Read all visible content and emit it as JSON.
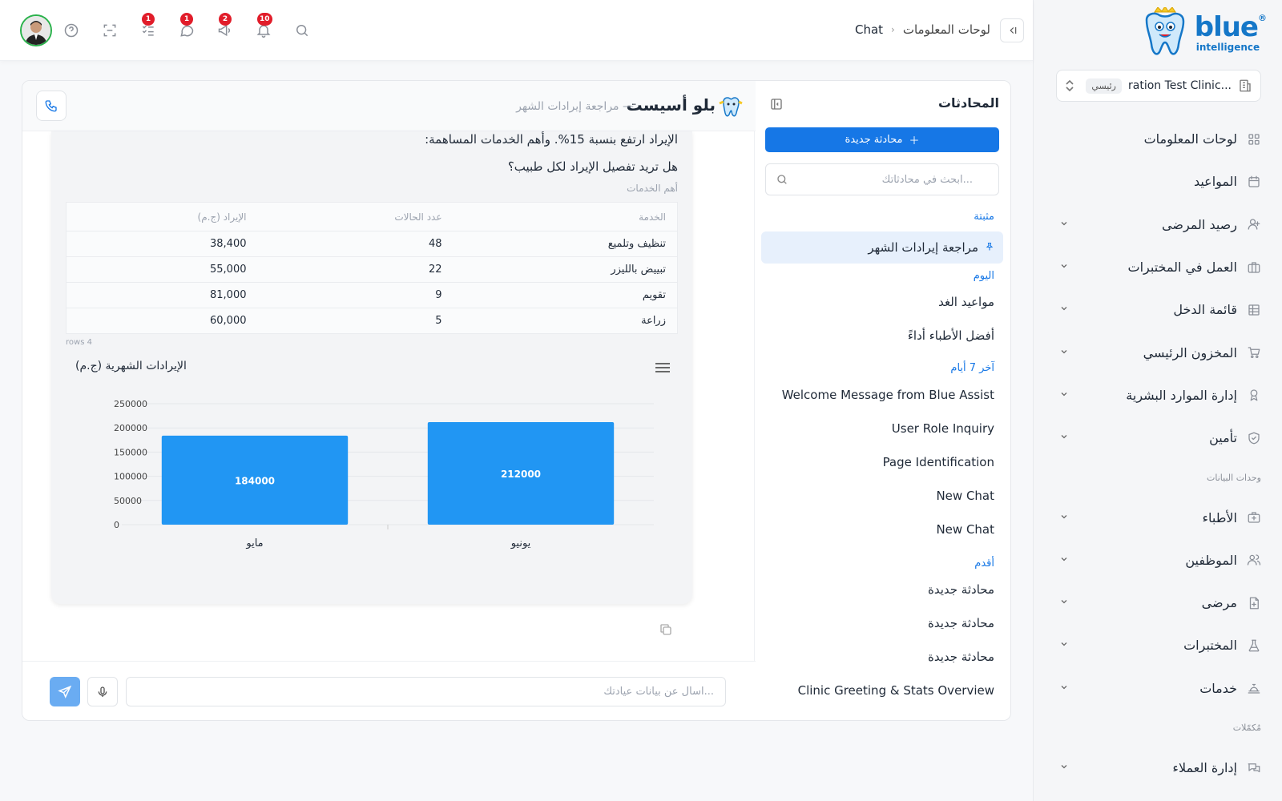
{
  "brand": {
    "name": "blue",
    "sub": "intelligence",
    "reg": "®"
  },
  "clinic": {
    "name": "...ration Test Clinic",
    "badge": "رئيسي"
  },
  "nav": {
    "items": [
      {
        "label": "لوحات المعلومات",
        "icon": "dashboard-icon",
        "chevron": false
      },
      {
        "label": "المواعيد",
        "icon": "calendar-icon",
        "chevron": false
      },
      {
        "label": "رصيد المرضى",
        "icon": "user-icon",
        "chevron": true
      },
      {
        "label": "العمل في المختبرات",
        "icon": "briefcase-icon",
        "chevron": true
      },
      {
        "label": "قائمة الدخل",
        "icon": "table-icon",
        "chevron": true
      },
      {
        "label": "المخزون الرئيسي",
        "icon": "cart-icon",
        "chevron": true
      },
      {
        "label": "إدارة الموارد البشرية",
        "icon": "badge-icon",
        "chevron": true
      },
      {
        "label": "تأمين",
        "icon": "shield-icon",
        "chevron": true
      }
    ],
    "section_data": "وحدات البيانات",
    "data_items": [
      {
        "label": "الأطباء",
        "icon": "medical-bag-icon",
        "chevron": true
      },
      {
        "label": "الموظفين",
        "icon": "users-icon",
        "chevron": true
      },
      {
        "label": "مرضى",
        "icon": "patient-file-icon",
        "chevron": true
      },
      {
        "label": "المختبرات",
        "icon": "flask-icon",
        "chevron": true
      },
      {
        "label": "خدمات",
        "icon": "service-bell-icon",
        "chevron": true
      }
    ],
    "section_misc": "مُكمّلات",
    "misc_items": [
      {
        "label": "إدارة العملاء",
        "icon": "chat-bubbles-icon",
        "chevron": true
      }
    ]
  },
  "topbar": {
    "breadcrumb_parent": "لوحات المعلومات",
    "breadcrumb_current": "Chat",
    "badges": {
      "tasks": "1",
      "messages": "1",
      "announcements": "2",
      "notifications": "10"
    }
  },
  "conversations": {
    "title": "المحادثات",
    "new_chat_label": "محادثة جديدة",
    "search_placeholder": "...ابحث في محادثاتك",
    "pinned_label": "مثبتة",
    "pinned_item": "مراجعة إيرادات الشهر",
    "today_label": "اليوم",
    "today_items": [
      "مواعيد الغد",
      "أفضل الأطباء أداءً"
    ],
    "week_label": "آخر 7 أيام",
    "week_items": [
      "Welcome Message from Blue Assist",
      "User Role Inquiry",
      "Page Identification",
      "New Chat",
      "New Chat"
    ],
    "older_label": "أقدم",
    "older_items": [
      "محادثة جديدة",
      "محادثة جديدة",
      "محادثة جديدة",
      "Clinic Greeting & Stats Overview"
    ]
  },
  "chat": {
    "assistant_name": "بلو أسيست",
    "subtitle": "— مراجعة إيرادات الشهر",
    "message_line1": "الإيراد ارتفع بنسبة 15%. وأهم الخدمات المساهمة:",
    "message_line2": "هل تريد تفصيل الإيراد لكل طبيب؟",
    "table_caption": "أهم الخدمات",
    "table": {
      "headers": [
        "الخدمة",
        "عدد الحالات",
        "الإيراد (ج.م)"
      ],
      "rows": [
        [
          "تنظيف وتلميع",
          "48",
          "38,400"
        ],
        [
          "تبييض بالليزر",
          "22",
          "55,000"
        ],
        [
          "تقويم",
          "9",
          "81,000"
        ],
        [
          "زراعة",
          "5",
          "60,000"
        ]
      ],
      "rows_count": "4 rows"
    },
    "input_placeholder": "...اسأل عن بيانات عيادتك"
  },
  "chart_data": {
    "type": "bar",
    "title": "الإيرادات الشهرية (ج.م)",
    "categories": [
      "مايو",
      "يونيو"
    ],
    "values": [
      184000,
      212000
    ],
    "yticks": [
      0,
      50000,
      100000,
      150000,
      200000,
      250000
    ],
    "ylim": [
      0,
      250000
    ],
    "grid": true,
    "color": "#2196f3"
  }
}
